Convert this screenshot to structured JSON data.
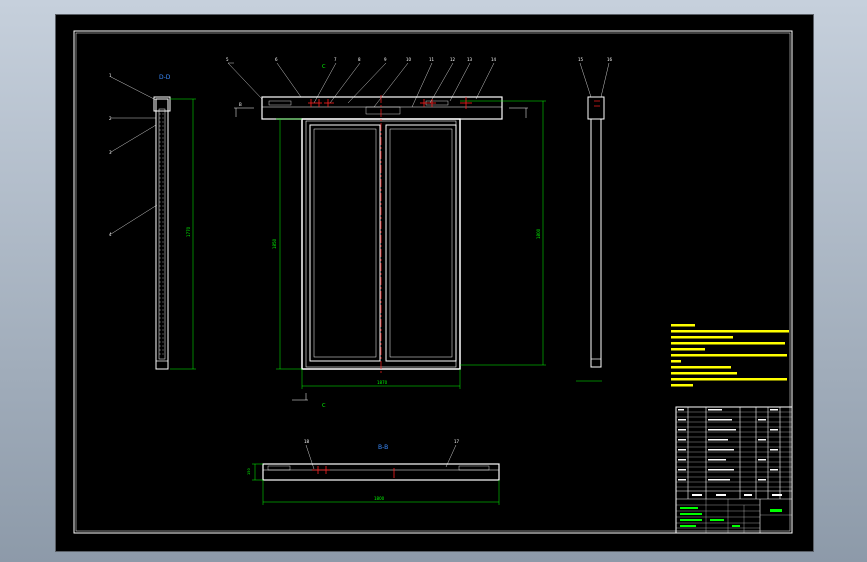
{
  "sheet": {
    "background": "#000000",
    "line_color": "#ffffff",
    "dim_color": "#00ff00",
    "center_color": "#ff2020",
    "label_color": "#3b8cff",
    "note_color": "#ffff00"
  },
  "views": {
    "left_view_label": "D-D",
    "front_section_mark_top": "C",
    "front_section_mark_bottom": "C",
    "bottom_view_label": "B-B"
  },
  "dimensions": {
    "left_height": "1770",
    "front_height_left": "1850",
    "front_height_right": "1800",
    "front_width": "1870",
    "bottom_width": "1800",
    "bottom_height": "150"
  },
  "leaders": {
    "left": [
      "1",
      "2",
      "3",
      "4"
    ],
    "front": [
      "5",
      "6",
      "7",
      "8",
      "9",
      "10",
      "11",
      "12",
      "13",
      "14"
    ],
    "right": [
      "15",
      "16"
    ],
    "bottom": [
      "18",
      "17"
    ]
  }
}
